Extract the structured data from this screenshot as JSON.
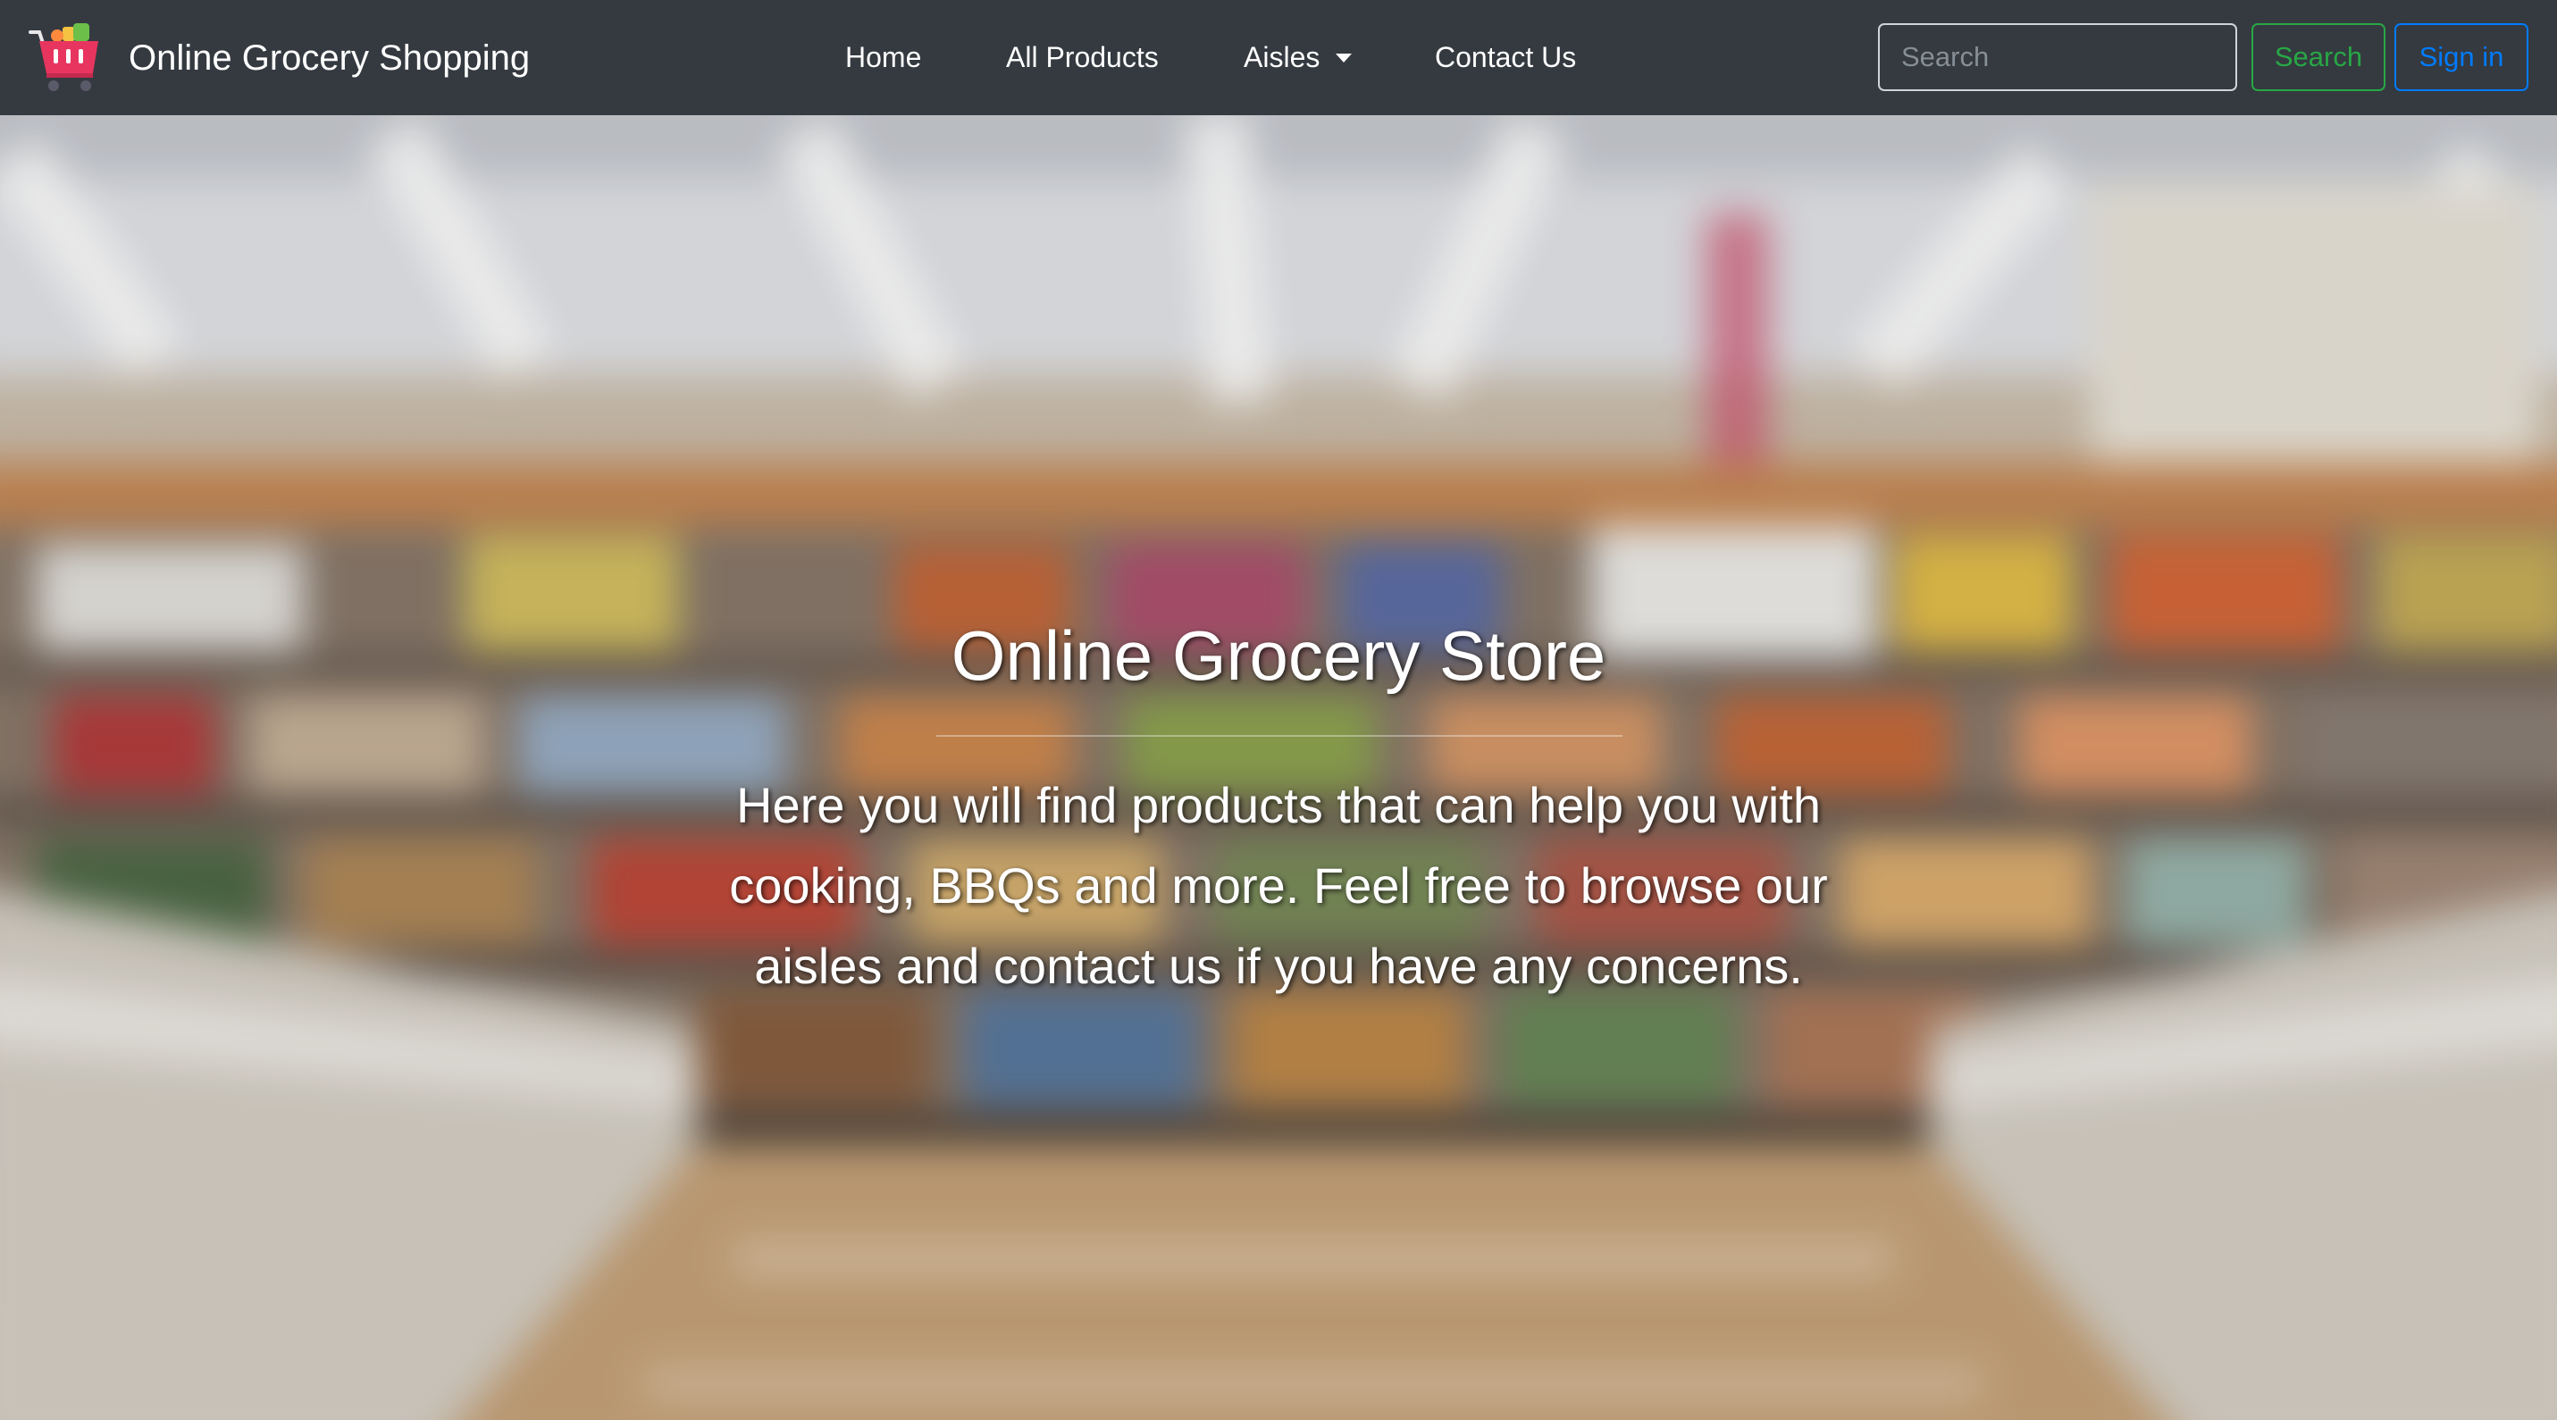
{
  "navbar": {
    "brand_label": "Online Grocery Shopping",
    "brand_icon": "shopping-cart-icon",
    "links": [
      {
        "label": "Home"
      },
      {
        "label": "All Products"
      },
      {
        "label": "Aisles",
        "has_dropdown": true
      },
      {
        "label": "Contact Us"
      }
    ],
    "search": {
      "placeholder": "Search",
      "value": "",
      "button_label": "Search"
    },
    "signin_label": "Sign in"
  },
  "hero": {
    "title": "Online Grocery Store",
    "lead": "Here you will find products that can help you with cooking, BBQs and more. Feel free to browse our aisles and contact us if you have any concerns."
  },
  "colors": {
    "navbar_bg": "#343a40",
    "search_button": "#28a745",
    "signin_button": "#007bff",
    "text_light": "#ffffff"
  }
}
